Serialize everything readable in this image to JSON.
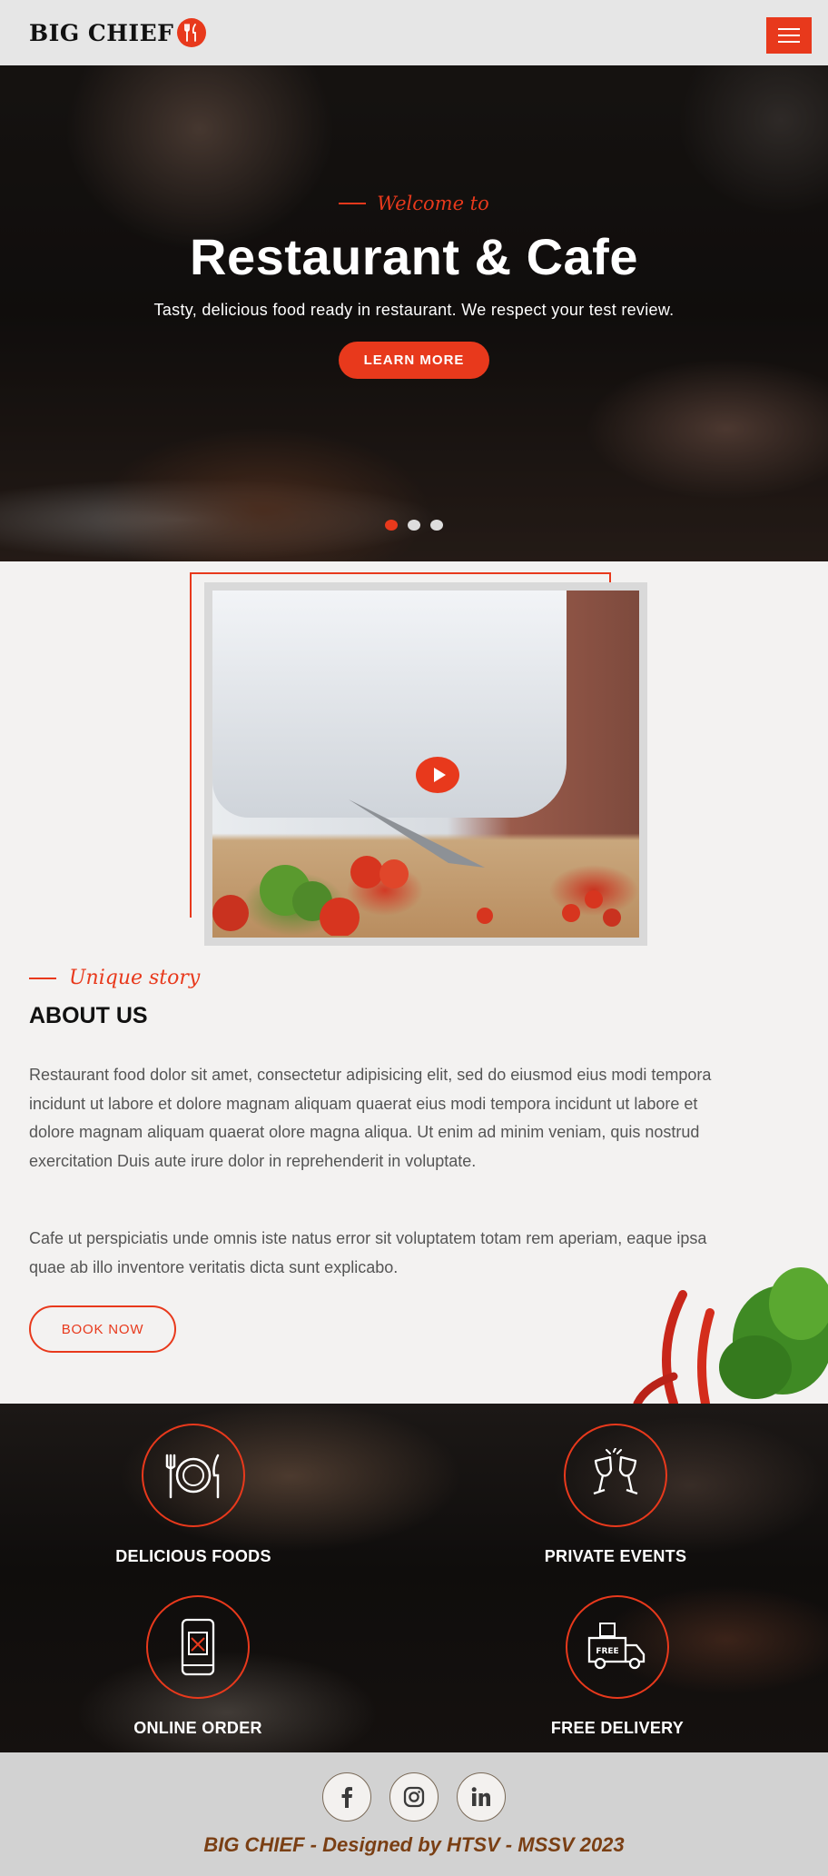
{
  "header": {
    "logo_text": "BIG CHIEF",
    "menu_icon": "hamburger-icon"
  },
  "hero": {
    "welcome": "Welcome to",
    "title": "Restaurant & Cafe",
    "text": "Tasty, delicious food ready in restaurant. We respect your test review.",
    "button_label": "LEARN MORE",
    "slides": 3,
    "active_slide": 1
  },
  "about": {
    "subtitle": "Unique story",
    "title": "ABOUT US",
    "paragraph1": "Restaurant food dolor sit amet, consectetur adipisicing elit, sed do eiusmod eius modi tempora incidunt ut labore et dolore magnam aliquam quaerat eius modi tempora incidunt ut labore et dolore magnam aliquam quaerat olore magna aliqua. Ut enim ad minim veniam, quis nostrud exercitation Duis aute irure dolor in reprehenderit in voluptate.",
    "paragraph2": "Cafe ut perspiciatis unde omnis iste natus error sit voluptatem totam rem aperiam, eaque ipsa quae ab illo inventore veritatis dicta sunt explicabo.",
    "button_label": "BOOK NOW"
  },
  "services": [
    {
      "label": "DELICIOUS FOODS",
      "icon": "plate-cutlery-icon"
    },
    {
      "label": "PRIVATE EVENTS",
      "icon": "wine-glasses-icon"
    },
    {
      "label": "ONLINE ORDER",
      "icon": "phone-order-icon"
    },
    {
      "label": "FREE DELIVERY",
      "icon": "delivery-truck-icon"
    }
  ],
  "footer": {
    "socials": [
      "facebook-icon",
      "instagram-icon",
      "linkedin-icon"
    ],
    "copyright": "BIG CHIEF - Designed by HTSV - MSSV 2023"
  },
  "colors": {
    "accent": "#e8391c",
    "footer_text": "#7a3f14"
  }
}
